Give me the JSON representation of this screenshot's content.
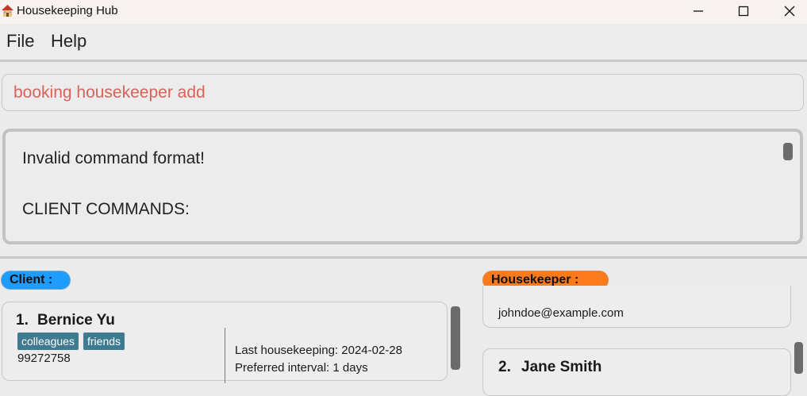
{
  "window": {
    "title": "Housekeeping Hub",
    "controls": {
      "minimize": "minimize-icon",
      "maximize": "maximize-icon",
      "close": "close-icon"
    }
  },
  "menu": {
    "items": [
      "File",
      "Help"
    ]
  },
  "command_box": {
    "value": "booking housekeeper add"
  },
  "result_display": {
    "lines": [
      "Invalid command format!",
      "CLIENT COMMANDS:"
    ]
  },
  "client_panel": {
    "header": "Client :",
    "header_color": "#1e9cff",
    "cards": [
      {
        "index": "1.",
        "name": "Bernice Yu",
        "tags": [
          "colleagues",
          "friends"
        ],
        "phone": "99272758",
        "details": [
          "Last housekeeping: 2024-02-28",
          "Preferred interval: 1 days"
        ]
      }
    ]
  },
  "housekeeper_panel": {
    "header": "Housekeeper :",
    "header_color": "#ff7a1a",
    "cards": [
      {
        "email": "johndoe@example.com"
      },
      {
        "index": "2.",
        "name": "Jane Smith"
      }
    ]
  }
}
